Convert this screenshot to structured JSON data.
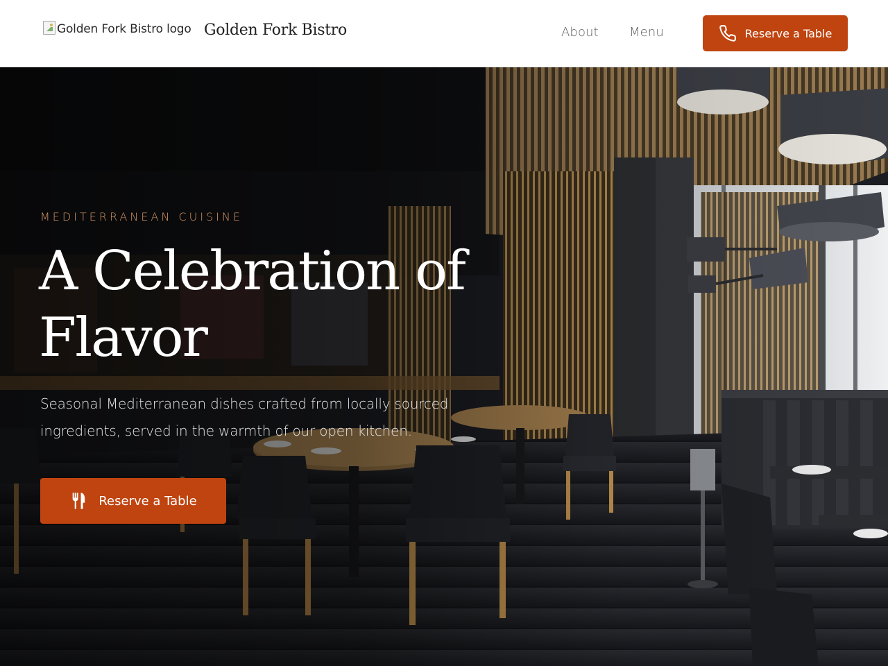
{
  "header": {
    "logo_alt": "Golden Fork Bistro logo",
    "brand_name": "Golden Fork Bistro",
    "nav": [
      {
        "label": "About"
      },
      {
        "label": "Menu"
      }
    ],
    "cta_label": "Reserve a Table",
    "cta_icon": "phone-icon"
  },
  "hero": {
    "eyebrow": "MEDITERRANEAN CUISINE",
    "headline": "A Celebration of Flavor",
    "subtext": "Seasonal Mediterranean dishes crafted from locally sourced ingredients, served in the warmth of our open kitchen.",
    "cta_label": "Reserve a Table",
    "cta_icon": "utensils-icon",
    "background_image": "restaurant-dining-room-photo"
  },
  "colors": {
    "accent": "#c0440f",
    "eyebrow": "#d99866",
    "header_bg": "#ffffff",
    "nav_text": "#5d5d5d"
  }
}
